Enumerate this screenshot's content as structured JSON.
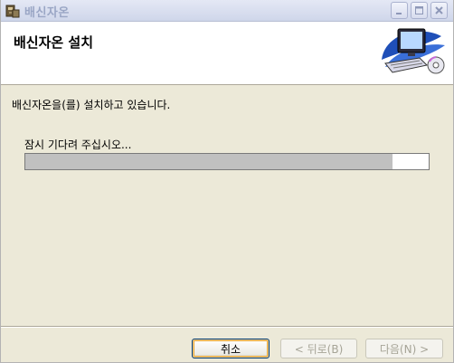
{
  "window": {
    "title": "배신자온"
  },
  "header": {
    "title": "배신자온 설치",
    "art_icon": "computer-install-icon"
  },
  "main": {
    "status_text": "배신자온을(를) 설치하고 있습니다.",
    "wait_text": "잠시 기다려 주십시오...",
    "progress_fraction": 0.91
  },
  "buttons": {
    "cancel": "취소",
    "back": "< 뒤로(B)",
    "next": "다음(N) >"
  },
  "colors": {
    "progress_fill": "#c0c0c0",
    "dialog_bg": "#ece9d8"
  }
}
